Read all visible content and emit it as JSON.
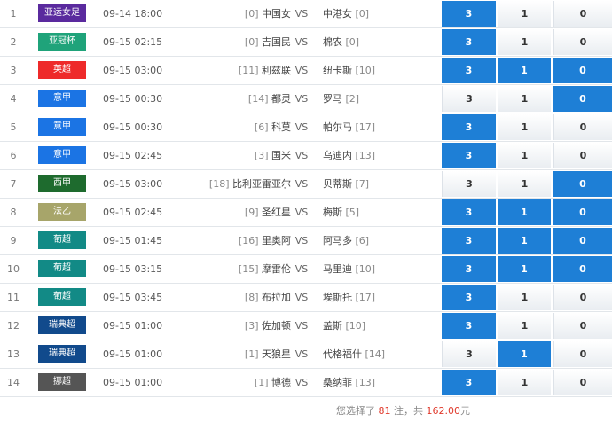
{
  "matches": [
    {
      "idx": "1",
      "league": "亚运女足",
      "league_color": "#5a2a9e",
      "time": "09-14 18:00",
      "home_rank": "[0]",
      "home": "中国女",
      "vs": "VS",
      "away": "中港女",
      "away_rank": "[0]",
      "sel": [
        true,
        false,
        false
      ],
      "opts": [
        "3",
        "1",
        "0"
      ]
    },
    {
      "idx": "2",
      "league": "亚冠杯",
      "league_color": "#1fa37a",
      "time": "09-15 02:15",
      "home_rank": "[0]",
      "home": "吉国民",
      "vs": "VS",
      "away": "棉农",
      "away_rank": "[0]",
      "sel": [
        true,
        false,
        false
      ],
      "opts": [
        "3",
        "1",
        "0"
      ]
    },
    {
      "idx": "3",
      "league": "英超",
      "league_color": "#ee2a2a",
      "time": "09-15 03:00",
      "home_rank": "[11]",
      "home": "利兹联",
      "vs": "VS",
      "away": "纽卡斯",
      "away_rank": "[10]",
      "sel": [
        true,
        true,
        true
      ],
      "opts": [
        "3",
        "1",
        "0"
      ]
    },
    {
      "idx": "4",
      "league": "意甲",
      "league_color": "#1b74e4",
      "time": "09-15 00:30",
      "home_rank": "[14]",
      "home": "都灵",
      "vs": "VS",
      "away": "罗马",
      "away_rank": "[2]",
      "sel": [
        false,
        false,
        true
      ],
      "opts": [
        "3",
        "1",
        "0"
      ]
    },
    {
      "idx": "5",
      "league": "意甲",
      "league_color": "#1b74e4",
      "time": "09-15 00:30",
      "home_rank": "[6]",
      "home": "科莫",
      "vs": "VS",
      "away": "帕尔马",
      "away_rank": "[17]",
      "sel": [
        true,
        false,
        false
      ],
      "opts": [
        "3",
        "1",
        "0"
      ]
    },
    {
      "idx": "6",
      "league": "意甲",
      "league_color": "#1b74e4",
      "time": "09-15 02:45",
      "home_rank": "[3]",
      "home": "国米",
      "vs": "VS",
      "away": "乌迪内",
      "away_rank": "[13]",
      "sel": [
        true,
        false,
        false
      ],
      "opts": [
        "3",
        "1",
        "0"
      ]
    },
    {
      "idx": "7",
      "league": "西甲",
      "league_color": "#1e6b2e",
      "time": "09-15 03:00",
      "home_rank": "[18]",
      "home": "比利亚雷亚尔",
      "vs": "VS",
      "away": "贝蒂斯",
      "away_rank": "[7]",
      "sel": [
        false,
        false,
        true
      ],
      "opts": [
        "3",
        "1",
        "0"
      ]
    },
    {
      "idx": "8",
      "league": "法乙",
      "league_color": "#a7a56a",
      "time": "09-15 02:45",
      "home_rank": "[9]",
      "home": "圣红星",
      "vs": "VS",
      "away": "梅斯",
      "away_rank": "[5]",
      "sel": [
        true,
        true,
        true
      ],
      "opts": [
        "3",
        "1",
        "0"
      ]
    },
    {
      "idx": "9",
      "league": "葡超",
      "league_color": "#128a86",
      "time": "09-15 01:45",
      "home_rank": "[16]",
      "home": "里奥阿",
      "vs": "VS",
      "away": "阿马多",
      "away_rank": "[6]",
      "sel": [
        true,
        true,
        true
      ],
      "opts": [
        "3",
        "1",
        "0"
      ]
    },
    {
      "idx": "10",
      "league": "葡超",
      "league_color": "#128a86",
      "time": "09-15 03:15",
      "home_rank": "[15]",
      "home": "摩雷伦",
      "vs": "VS",
      "away": "马里迪",
      "away_rank": "[10]",
      "sel": [
        true,
        true,
        true
      ],
      "opts": [
        "3",
        "1",
        "0"
      ]
    },
    {
      "idx": "11",
      "league": "葡超",
      "league_color": "#128a86",
      "time": "09-15 03:45",
      "home_rank": "[8]",
      "home": "布拉加",
      "vs": "VS",
      "away": "埃斯托",
      "away_rank": "[17]",
      "sel": [
        true,
        false,
        false
      ],
      "opts": [
        "3",
        "1",
        "0"
      ]
    },
    {
      "idx": "12",
      "league": "瑞典超",
      "league_color": "#114a8c",
      "time": "09-15 01:00",
      "home_rank": "[3]",
      "home": "佐加顿",
      "vs": "VS",
      "away": "盖斯",
      "away_rank": "[10]",
      "sel": [
        true,
        false,
        false
      ],
      "opts": [
        "3",
        "1",
        "0"
      ]
    },
    {
      "idx": "13",
      "league": "瑞典超",
      "league_color": "#114a8c",
      "time": "09-15 01:00",
      "home_rank": "[1]",
      "home": "天狼星",
      "vs": "VS",
      "away": "代格福什",
      "away_rank": "[14]",
      "sel": [
        false,
        true,
        false
      ],
      "opts": [
        "3",
        "1",
        "0"
      ]
    },
    {
      "idx": "14",
      "league": "挪超",
      "league_color": "#555555",
      "time": "09-15 01:00",
      "home_rank": "[1]",
      "home": "博德",
      "vs": "VS",
      "away": "桑纳菲",
      "away_rank": "[13]",
      "sel": [
        true,
        false,
        false
      ],
      "opts": [
        "3",
        "1",
        "0"
      ]
    }
  ],
  "summary": {
    "prefix": "您选择了 ",
    "notes": "81",
    "middle": " 注，共 ",
    "amount": "162.00",
    "suffix": "元"
  }
}
